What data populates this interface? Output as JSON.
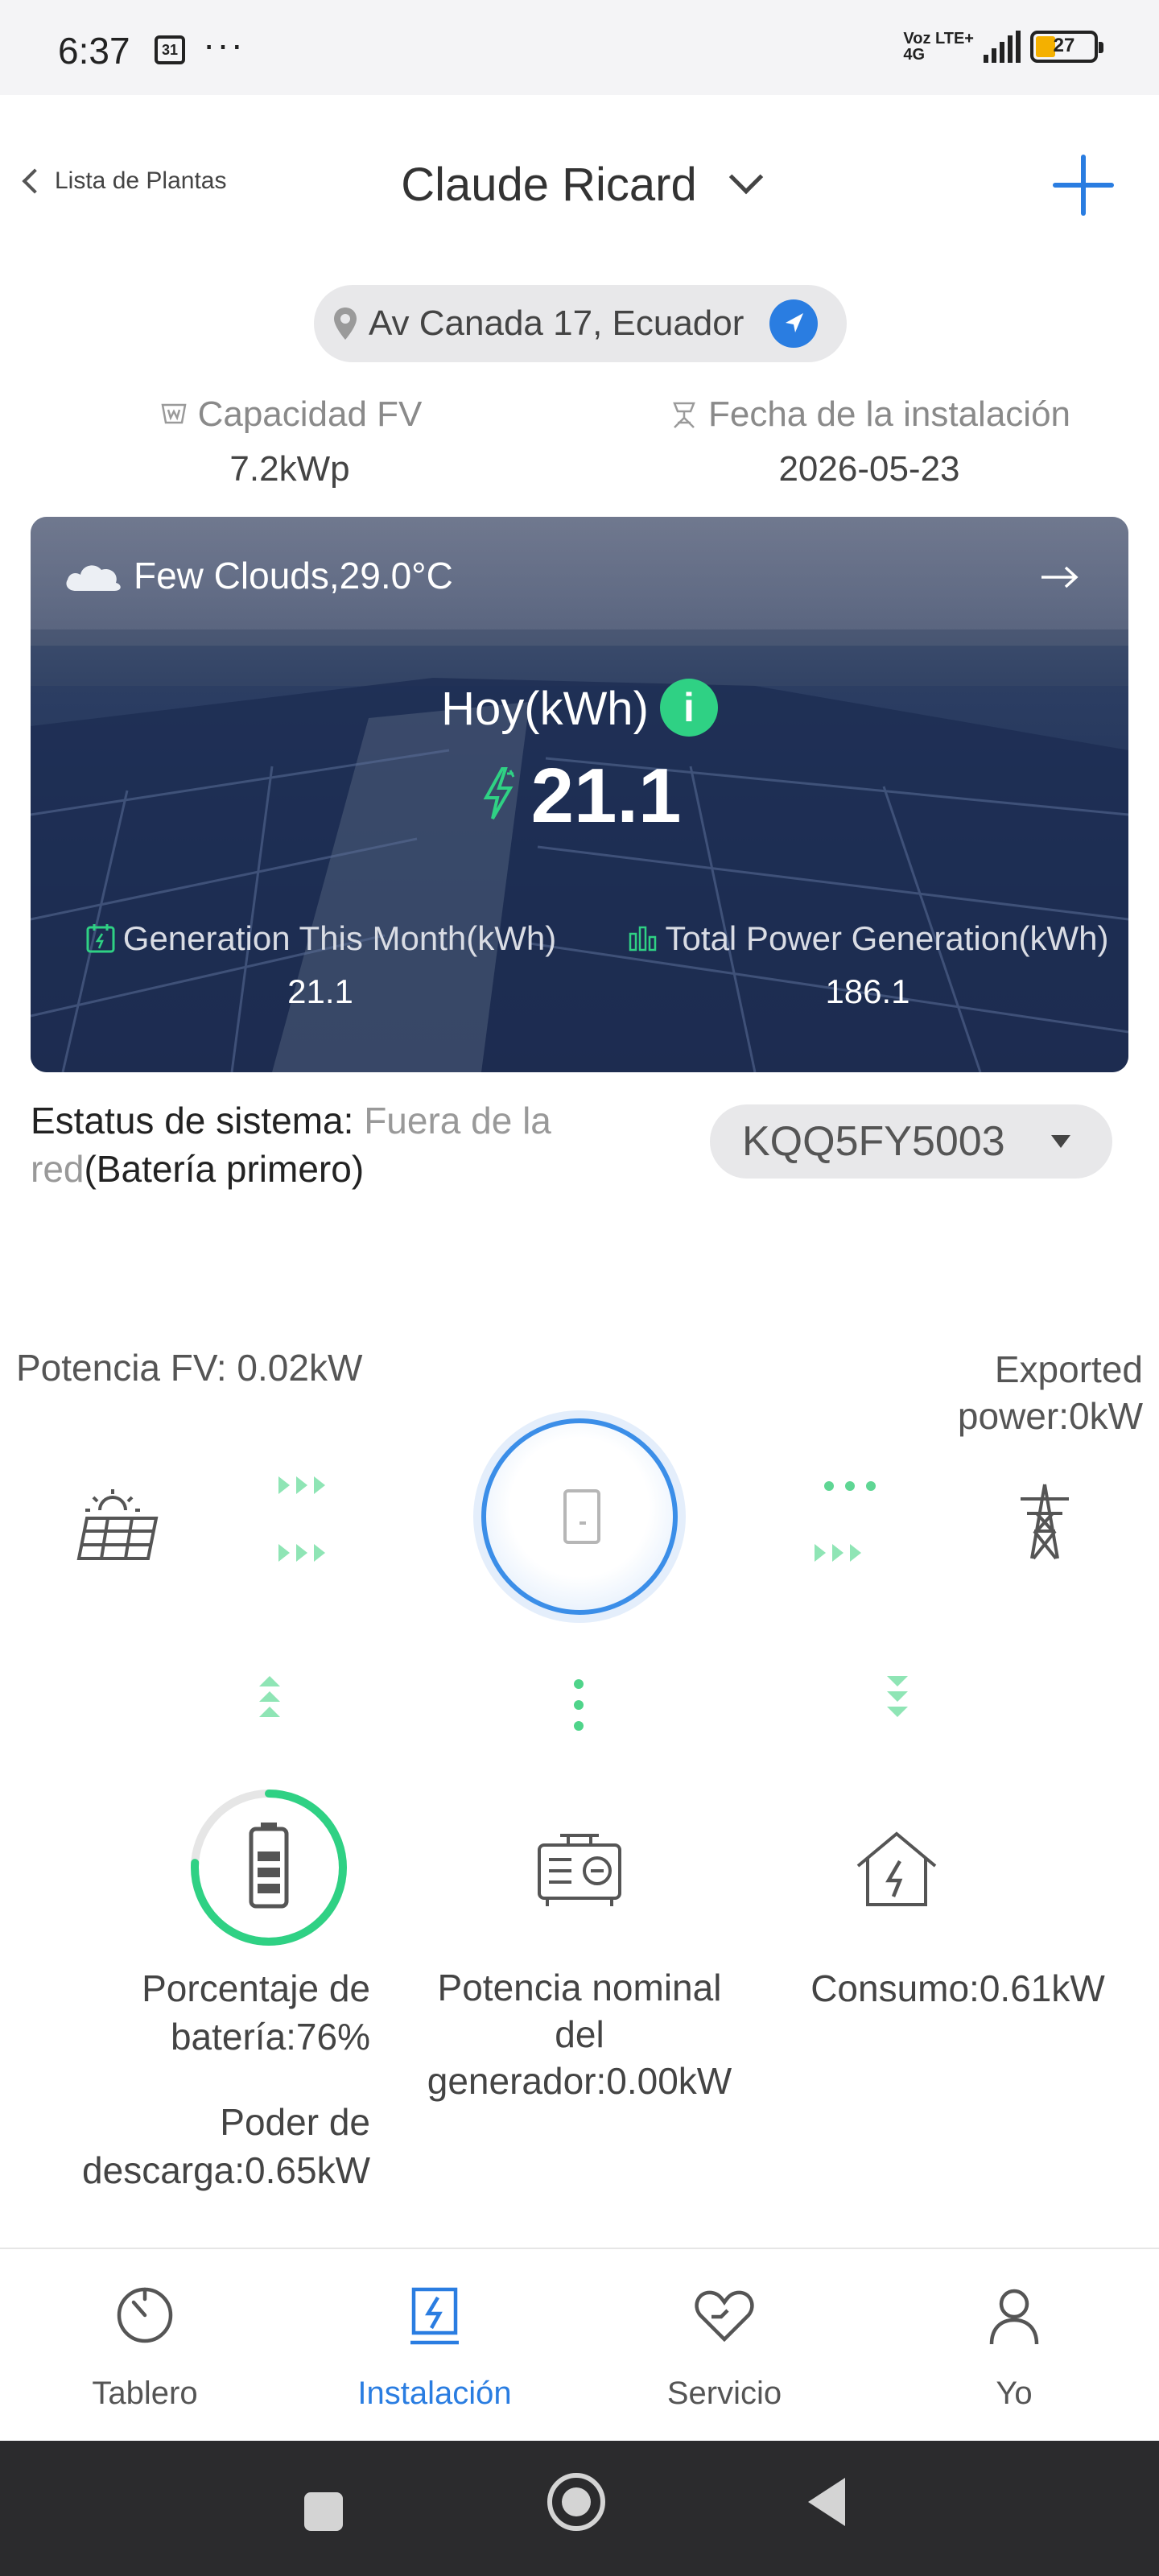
{
  "status_bar": {
    "time": "6:37",
    "calendar_day": "31",
    "more": "···",
    "network_top": "Voz LTE+",
    "network_bottom": "4G",
    "battery": "27"
  },
  "header": {
    "back_label": "Lista de Plantas",
    "title": "Claude Ricard",
    "add_icon": "plus-icon"
  },
  "location": {
    "address": "Av Canada 17, Ecuador"
  },
  "meta": {
    "capacity_label": "Capacidad FV",
    "capacity_value": "7.2kWp",
    "install_label": "Fecha de la instalación",
    "install_value": "2026-05-23"
  },
  "card": {
    "weather": "Few Clouds,29.0°C",
    "today_label": "Hoy(kWh)",
    "today_value": "21.1",
    "month_label": "Generation This Month(kWh)",
    "month_value": "21.1",
    "total_label": "Total Power Generation(kWh)",
    "total_value": "186.1"
  },
  "system": {
    "status_label": "Estatus de sistema: ",
    "status_offgrid": "Fuera de la red",
    "status_mode": "(Batería primero)",
    "device": "KQQ5FY5003"
  },
  "flow": {
    "pv_power": "Potencia FV: 0.02kW",
    "exported_power": "Exported power:0kW",
    "battery_percent": "Porcentaje de batería:76%",
    "battery_level": 0.76,
    "discharge_power": "Poder de descarga:0.65kW",
    "generator_power": "Potencia nominal del generador:0.00kW",
    "consumption": "Consumo:0.61kW"
  },
  "tabs": [
    {
      "label": "Tablero",
      "icon": "gauge-icon"
    },
    {
      "label": "Instalación",
      "icon": "installation-icon"
    },
    {
      "label": "Servicio",
      "icon": "heart-icon"
    },
    {
      "label": "Yo",
      "icon": "user-icon"
    }
  ],
  "active_tab": "Instalación",
  "colors": {
    "accent": "#2a7de1",
    "green": "#2fd184",
    "arrow_green": "#8fe5b5"
  }
}
